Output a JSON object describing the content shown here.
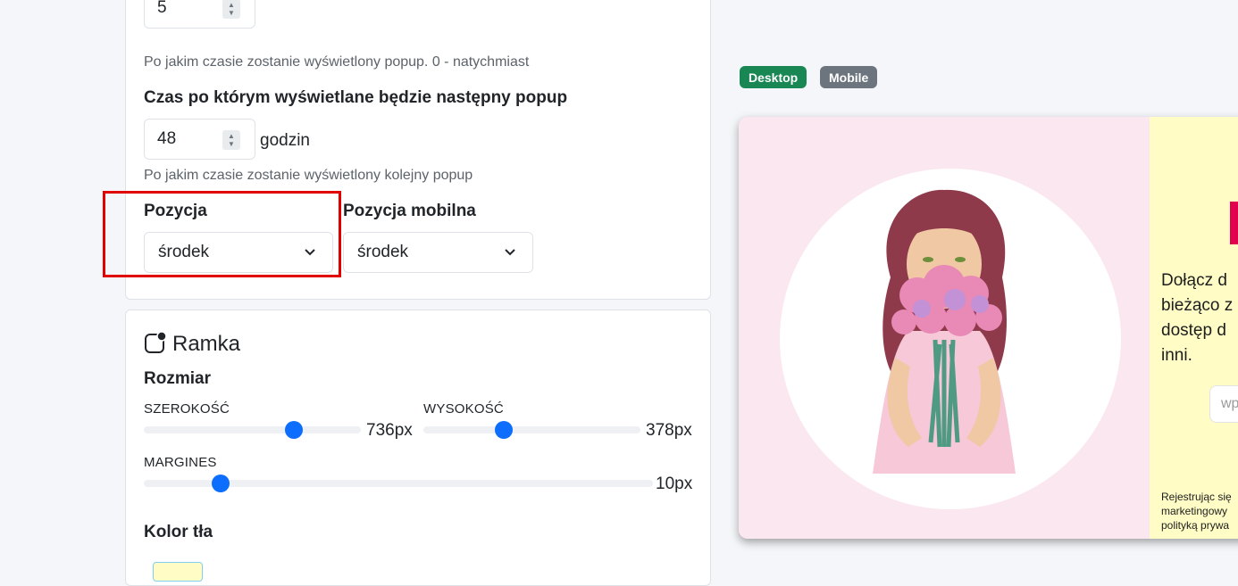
{
  "delay": {
    "value": "5",
    "help": "Po jakim czasie zostanie wyświetlony popup. 0 - natychmiast"
  },
  "next_popup": {
    "label": "Czas po którym wyświetlane będzie następny popup",
    "value": "48",
    "unit": "godzin",
    "help": "Po jakim czasie zostanie wyświetlony kolejny popup"
  },
  "position": {
    "label": "Pozycja",
    "selected": "środek"
  },
  "mobile_position": {
    "label": "Pozycja mobilna",
    "selected": "środek"
  },
  "frame": {
    "title": "Ramka",
    "size_label": "Rozmiar",
    "width_label": "SZEROKOŚĆ",
    "width_value": "736px",
    "width_fraction": 0.69,
    "height_label": "WYSOKOŚĆ",
    "height_value": "378px",
    "height_fraction": 0.37,
    "margin_label": "MARGINES",
    "margin_value": "10px",
    "margin_fraction": 0.15,
    "bg_color_label": "Kolor tła"
  },
  "preview_tabs": {
    "desktop": "Desktop",
    "mobile": "Mobile"
  },
  "preview": {
    "text_lines": [
      "Dołącz d",
      "bieżąco z",
      "dostęp d",
      "inni."
    ],
    "input_placeholder": "wp",
    "small_lines": [
      "Rejestrując się",
      "marketingowy",
      "polityką prywa"
    ]
  },
  "colors": {
    "accent": "#0d6efd",
    "highlight": "#e00000",
    "desktop_badge": "#198754",
    "mobile_badge": "#6c757d",
    "preview_left_bg": "#fbe7ef",
    "preview_right_bg": "#fffdc5",
    "promo_accent": "#e0004d"
  }
}
